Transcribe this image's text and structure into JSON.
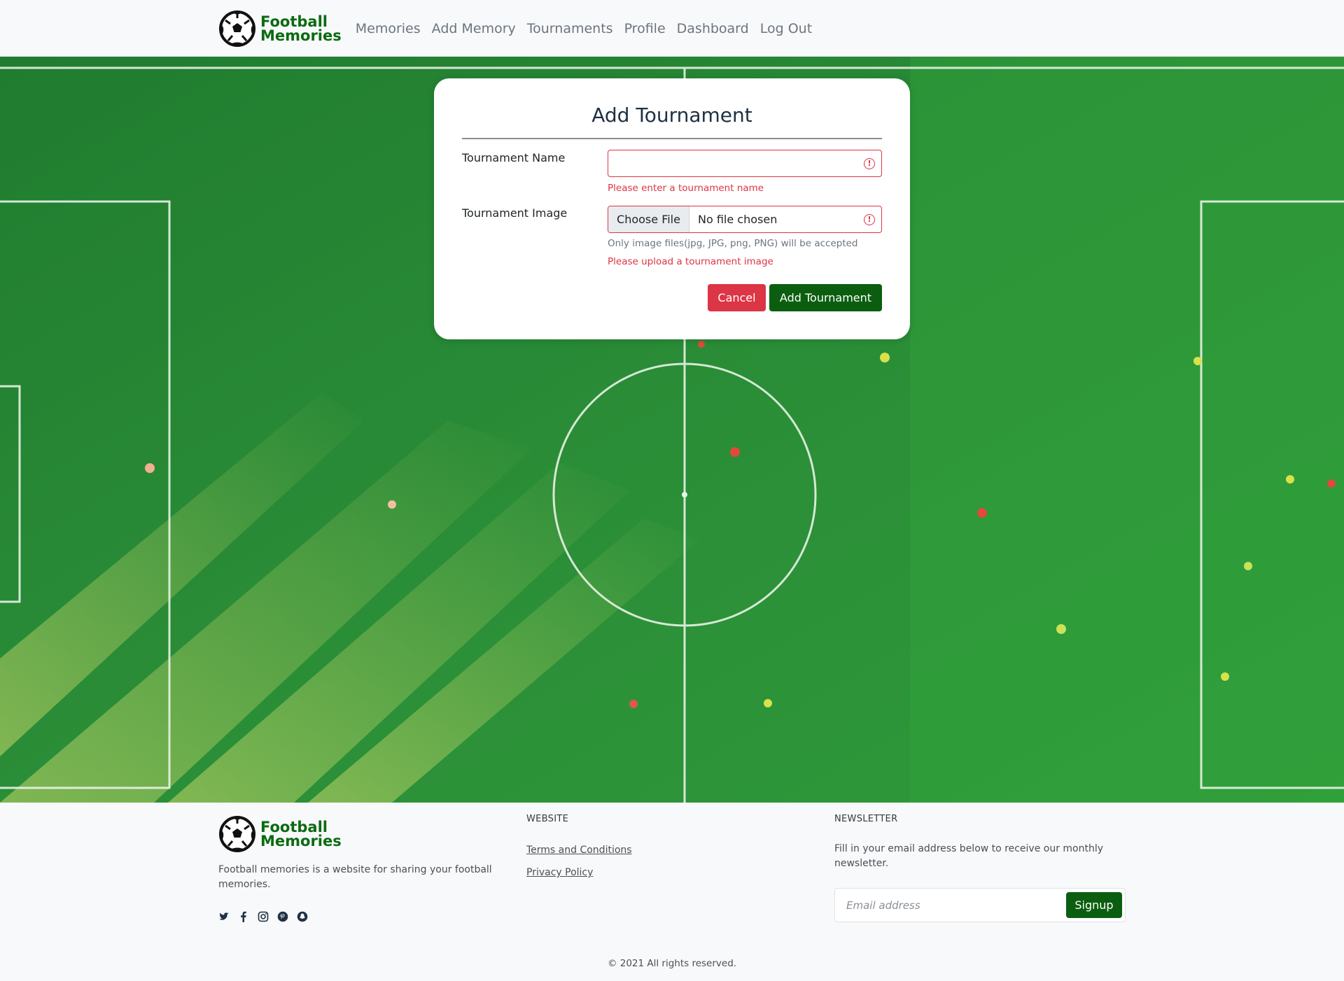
{
  "brand": {
    "line1": "Football",
    "line2": "Memories",
    "color": "#0b6b12"
  },
  "nav": {
    "links": [
      "Memories",
      "Add Memory",
      "Tournaments",
      "Profile",
      "Dashboard",
      "Log Out"
    ]
  },
  "form": {
    "title": "Add Tournament",
    "name_label": "Tournament Name",
    "name_value": "",
    "name_error": "Please enter a tournament name",
    "image_label": "Tournament Image",
    "file_button": "Choose File",
    "file_status": "No file chosen",
    "image_help": "Only image files(jpg, JPG, png, PNG) will be accepted",
    "image_error": "Please upload a tournament image",
    "cancel_label": "Cancel",
    "submit_label": "Add Tournament"
  },
  "footer": {
    "description": "Football memories is a website for sharing your football memories.",
    "social_icons": [
      "twitter-icon",
      "facebook-icon",
      "instagram-icon",
      "pinterest-icon",
      "snapchat-icon"
    ],
    "website_heading": "WEBSITE",
    "links": [
      "Terms and Conditions",
      "Privacy Policy"
    ],
    "newsletter_heading": "NEWSLETTER",
    "newsletter_text": "Fill in your email address below to receive our monthly newsletter.",
    "email_placeholder": "Email address",
    "signup_label": "Signup",
    "copyright": "© 2021 All rights reserved."
  },
  "colors": {
    "danger": "#dc3545",
    "primary_green": "#0b5e0f",
    "pitch": "#2a8a32"
  }
}
